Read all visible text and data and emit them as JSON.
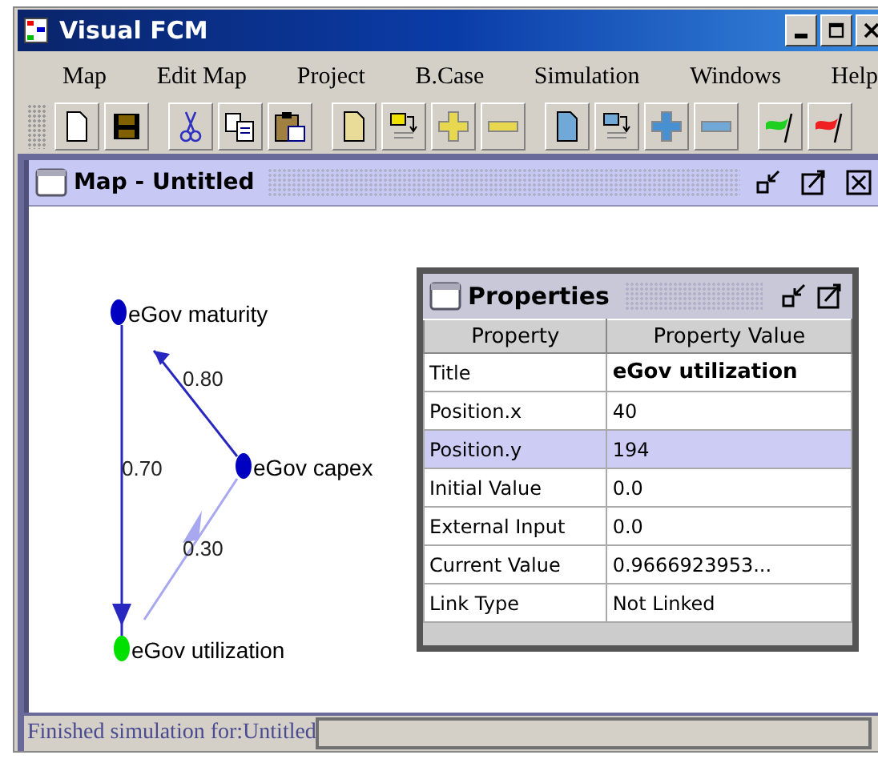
{
  "window": {
    "title": "Visual FCM"
  },
  "menu": [
    "Map",
    "Edit Map",
    "Project",
    "B.Case",
    "Simulation",
    "Windows",
    "Help"
  ],
  "map_window": {
    "title": "Map - Untitled",
    "nodes": [
      {
        "label": "eGov maturity",
        "color": "#0000c0"
      },
      {
        "label": "eGov capex",
        "color": "#0000c0"
      },
      {
        "label": "eGov utilization",
        "color": "#00e000"
      }
    ],
    "edges": [
      {
        "weight": "0.80",
        "color": "#2828c0"
      },
      {
        "weight": "0.70",
        "color": "#2828c0"
      },
      {
        "weight": "0.30",
        "color": "#a8a8f0"
      }
    ]
  },
  "properties": {
    "title": "Properties",
    "columns": [
      "Property",
      "Property Value"
    ],
    "rows": [
      {
        "property": "Title",
        "value": "eGov utilization",
        "selected": false,
        "bold": true
      },
      {
        "property": "Position.x",
        "value": "40",
        "selected": false,
        "bold": false
      },
      {
        "property": "Position.y",
        "value": "194",
        "selected": true,
        "bold": false
      },
      {
        "property": "Initial Value",
        "value": "0.0",
        "selected": false,
        "bold": false
      },
      {
        "property": "External Input",
        "value": "0.0",
        "selected": false,
        "bold": false
      },
      {
        "property": "Current Value",
        "value": "0.9666923953...",
        "selected": false,
        "bold": false
      },
      {
        "property": "Link Type",
        "value": "Not Linked",
        "selected": false,
        "bold": false
      }
    ]
  },
  "status_bar": {
    "text": "Finished simulation for:Untitled"
  }
}
